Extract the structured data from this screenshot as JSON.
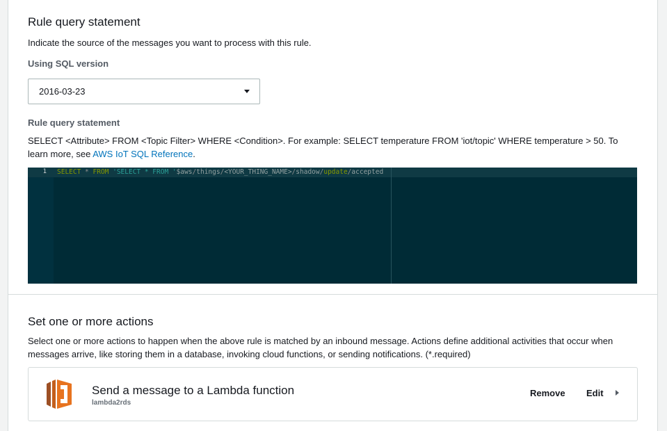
{
  "query_section": {
    "title": "Rule query statement",
    "description": "Indicate the source of the messages you want to process with this rule.",
    "sql_version_label": "Using SQL version",
    "sql_version_value": "2016-03-23",
    "statement_label": "Rule query statement",
    "help_text": "SELECT <Attribute> FROM <Topic Filter> WHERE <Condition>. For example: SELECT temperature FROM 'iot/topic' WHERE temperature > 50. To learn more, see ",
    "help_link": "AWS IoT SQL Reference",
    "help_suffix": "."
  },
  "editor": {
    "line_number": "1",
    "tokens": {
      "t1": "SELECT",
      "t2": " * ",
      "t3": "FROM",
      "t4": " 'SELECT * FROM '",
      "t5": "$aws",
      "t6": "/",
      "t7": "things",
      "t8": "/",
      "t9": "<YOUR_THING_NAME>",
      "t10": "/",
      "t11": "shadow",
      "t12": "/",
      "t13": "update",
      "t14": "/",
      "t15": "accepted"
    }
  },
  "actions_section": {
    "title": "Set one or more actions",
    "description": "Select one or more actions to happen when the above rule is matched by an inbound message. Actions define additional activities that occur when messages arrive, like storing them in a database, invoking cloud functions, or sending notifications. (*.required)",
    "action": {
      "icon": "lambda-icon",
      "title": "Send a message to a Lambda function",
      "subtitle": "lambda2rds",
      "remove_label": "Remove",
      "edit_label": "Edit"
    }
  },
  "colors": {
    "editor_bg": "#002b36",
    "link": "#0073bb",
    "lambda_orange": "#e7731f"
  }
}
